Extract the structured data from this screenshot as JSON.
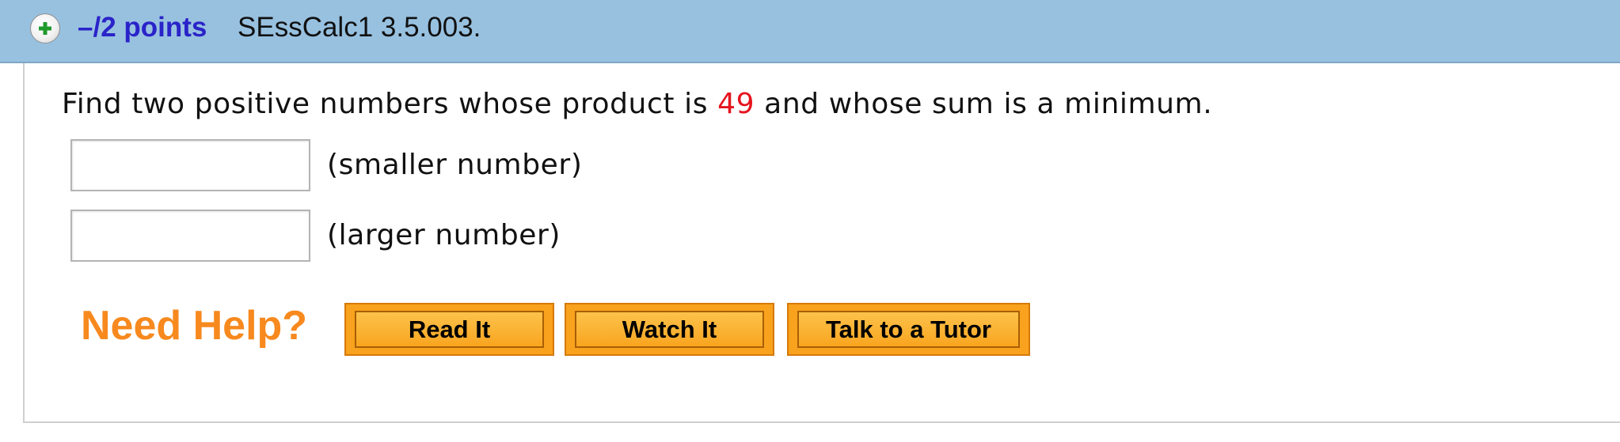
{
  "header": {
    "points": "–/2 points",
    "question_id": "SEssCalc1 3.5.003."
  },
  "question": {
    "text_before": "Find two positive numbers whose product is ",
    "highlight_number": "49",
    "text_after": " and whose sum is a minimum."
  },
  "answers": [
    {
      "label": "(smaller number)",
      "value": ""
    },
    {
      "label": "(larger number)",
      "value": ""
    }
  ],
  "help": {
    "title": "Need Help?",
    "buttons": [
      "Read It",
      "Watch It",
      "Talk to a Tutor"
    ]
  },
  "colors": {
    "header_bg": "#98c1e0",
    "points_text": "#2a23c9",
    "highlight_number": "#e5141e",
    "need_help_text": "#f7891e",
    "button_bg": "#f9a21d"
  },
  "icons": {
    "expand": "plus-circle-icon"
  }
}
